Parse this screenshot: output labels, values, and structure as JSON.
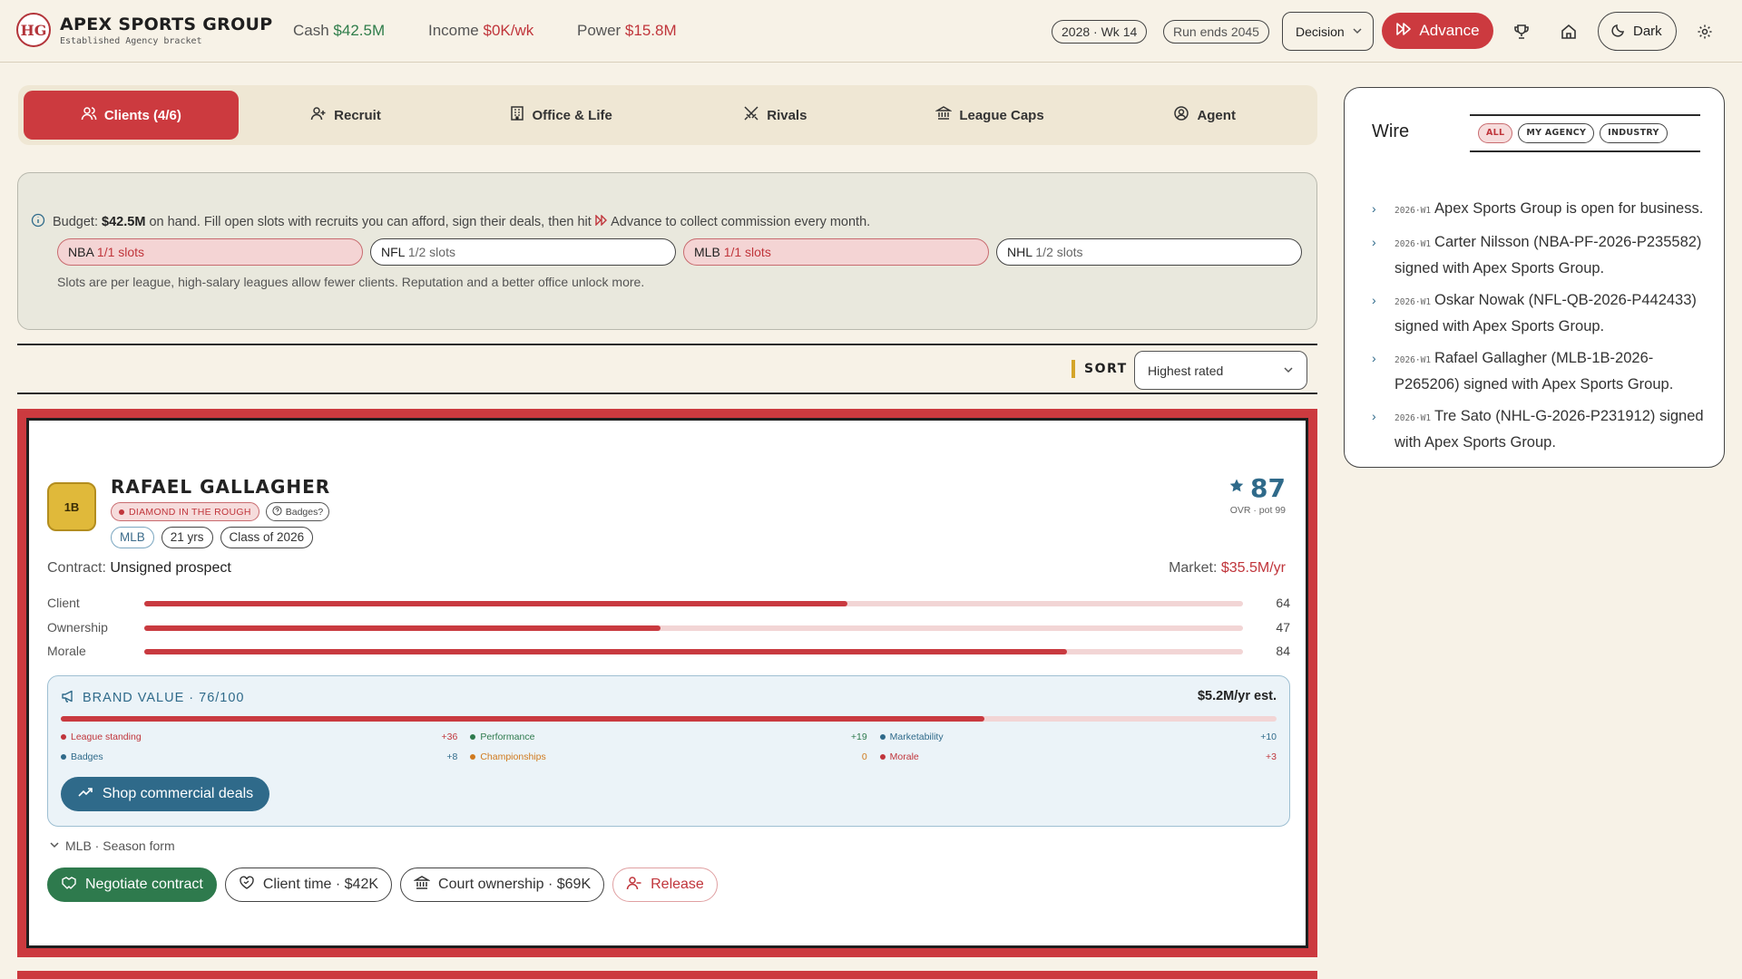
{
  "header": {
    "logo_text": "HG",
    "brand_name": "APEX SPORTS GROUP",
    "brand_sub": "Established Agency bracket",
    "cash_label": "Cash",
    "cash_value": "$42.5M",
    "income_label": "Income",
    "income_value": "$0K/wk",
    "power_label": "Power",
    "power_value": "$15.8M",
    "date_pill": "2028 · Wk 14",
    "run_pill": "Run ends 2045",
    "decision_label": "Decision",
    "advance_label": "Advance",
    "theme_label": "Dark"
  },
  "tabs": [
    {
      "label": "Clients (4/6)",
      "icon": "users-icon",
      "active": true
    },
    {
      "label": "Recruit",
      "icon": "user-plus-icon"
    },
    {
      "label": "Office & Life",
      "icon": "building-icon"
    },
    {
      "label": "Rivals",
      "icon": "swords-icon"
    },
    {
      "label": "League Caps",
      "icon": "bank-icon"
    },
    {
      "label": "Agent",
      "icon": "user-circle-icon"
    }
  ],
  "info": {
    "budget_pre": "Budget:",
    "budget_value": "$42.5M",
    "budget_post": "on hand. Fill open slots with recruits you can afford, sign their deals, then hit",
    "budget_end": "Advance to collect commission every month.",
    "slots": [
      {
        "league": "NBA",
        "count": "1/1 slots",
        "full": true
      },
      {
        "league": "NFL",
        "count": "1/2 slots",
        "full": false
      },
      {
        "league": "MLB",
        "count": "1/1 slots",
        "full": true
      },
      {
        "league": "NHL",
        "count": "1/2 slots",
        "full": false
      }
    ],
    "note": "Slots are per league, high-salary leagues allow fewer clients. Reputation and a better office unlock more."
  },
  "sort": {
    "label": "SORT",
    "value": "Highest rated"
  },
  "client": {
    "position": "1B",
    "name": "RAFAEL GALLAGHER",
    "tag": "DIAMOND IN THE ROUGH",
    "badges_q": "Badges?",
    "league": "MLB",
    "age": "21 yrs",
    "class": "Class of 2026",
    "ovr": "87",
    "ovr_sub": "OVR · pot 99",
    "contract_label": "Contract:",
    "contract_value": "Unsigned prospect",
    "market_label": "Market:",
    "market_value": "$35.5M/yr",
    "meters": [
      {
        "label": "Client",
        "value": 64
      },
      {
        "label": "Ownership",
        "value": 47
      },
      {
        "label": "Morale",
        "value": 84
      }
    ],
    "brand_title": "BRAND VALUE · 76/100",
    "brand_value": 76,
    "brand_est": "$5.2M/yr est.",
    "factors": [
      {
        "label": "League standing",
        "value": "+36",
        "color": "#c0353b"
      },
      {
        "label": "Performance",
        "value": "+19",
        "color": "#2e7a4d"
      },
      {
        "label": "Marketability",
        "value": "+10",
        "color": "#2f6a8a"
      },
      {
        "label": "Badges",
        "value": "+8",
        "color": "#2f6a8a"
      },
      {
        "label": "Championships",
        "value": "0",
        "color": "#d07a1e"
      },
      {
        "label": "Morale",
        "value": "+3",
        "color": "#c0353b"
      }
    ],
    "shop_label": "Shop commercial deals",
    "season_label": "MLB · Season form",
    "actions": {
      "negotiate": "Negotiate contract",
      "client_time": "Client time · $42K",
      "ownership": "Court ownership · $69K",
      "release": "Release"
    }
  },
  "wire": {
    "title": "Wire",
    "filters": [
      "ALL",
      "MY AGENCY",
      "INDUSTRY"
    ],
    "items": [
      {
        "week": "2026·W1",
        "text": "Apex Sports Group is open for business."
      },
      {
        "week": "2026·W1",
        "text": "Carter Nilsson (NBA-PF-2026-P235582) signed with Apex Sports Group."
      },
      {
        "week": "2026·W1",
        "text": "Oskar Nowak (NFL-QB-2026-P442433) signed with Apex Sports Group."
      },
      {
        "week": "2026·W1",
        "text": "Rafael Gallagher (MLB-1B-2026-P265206) signed with Apex Sports Group."
      },
      {
        "week": "2026·W1",
        "text": "Tre Sato (NHL-G-2026-P231912) signed with Apex Sports Group."
      }
    ]
  },
  "colors": {
    "accent": "#cc3a3f",
    "green": "#2e7a4d",
    "blue": "#2f6a8a",
    "gold": "#e0b93a",
    "bg": "#f7f2e7"
  }
}
